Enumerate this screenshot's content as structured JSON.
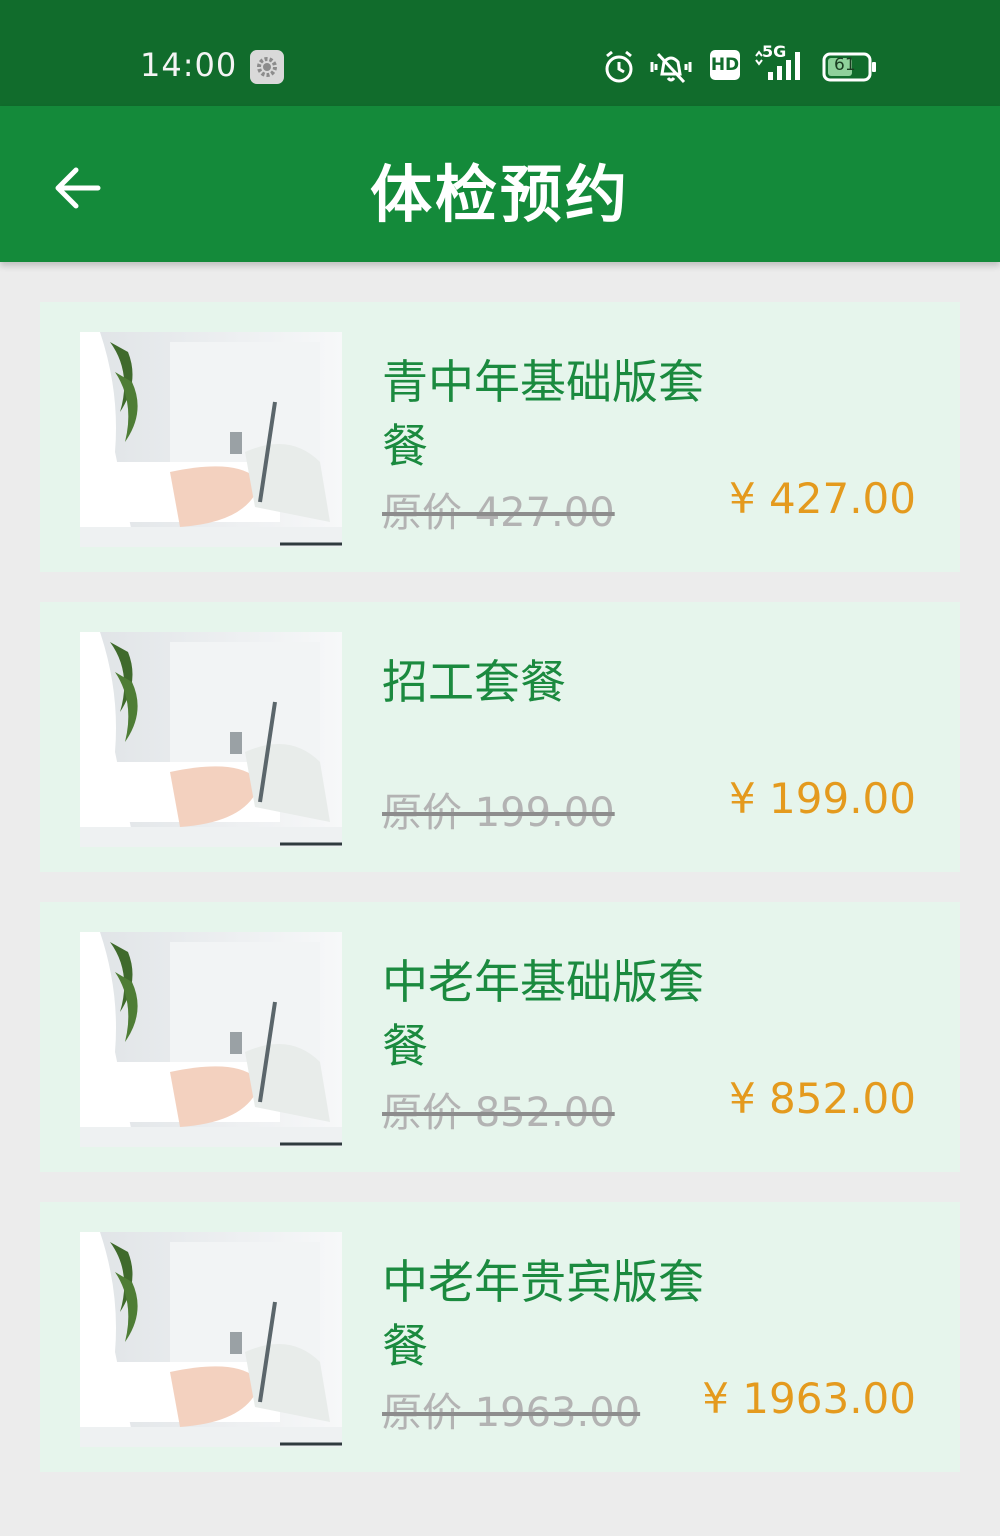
{
  "status_bar": {
    "time": "14:00",
    "network": "5G",
    "hd_label": "HD",
    "battery": "61",
    "icons": [
      "settings-icon",
      "alarm-icon",
      "vibrate-off-icon",
      "hd-icon",
      "signal-5g-icon",
      "battery-icon"
    ]
  },
  "header": {
    "title": "体检预约",
    "back_icon": "arrow-left-icon"
  },
  "colors": {
    "status_bar": "#116c2c",
    "header": "#148a3a",
    "card_bg": "#e6f5ec",
    "name_text": "#1b8a3f",
    "price_text": "#e49a1e",
    "original_price_text": "#b3b3b3",
    "page_bg": "#ececec"
  },
  "packages": [
    {
      "name": "青中年基础版套餐",
      "original_price": "原价 427.00",
      "price": "¥ 427.00"
    },
    {
      "name": "招工套餐",
      "original_price": "原价 199.00",
      "price": "¥ 199.00"
    },
    {
      "name": "中老年基础版套餐",
      "original_price": "原价 852.00",
      "price": "¥ 852.00"
    },
    {
      "name": "中老年贵宾版套餐",
      "original_price": "原价 1963.00",
      "price": "¥ 1963.00"
    }
  ]
}
